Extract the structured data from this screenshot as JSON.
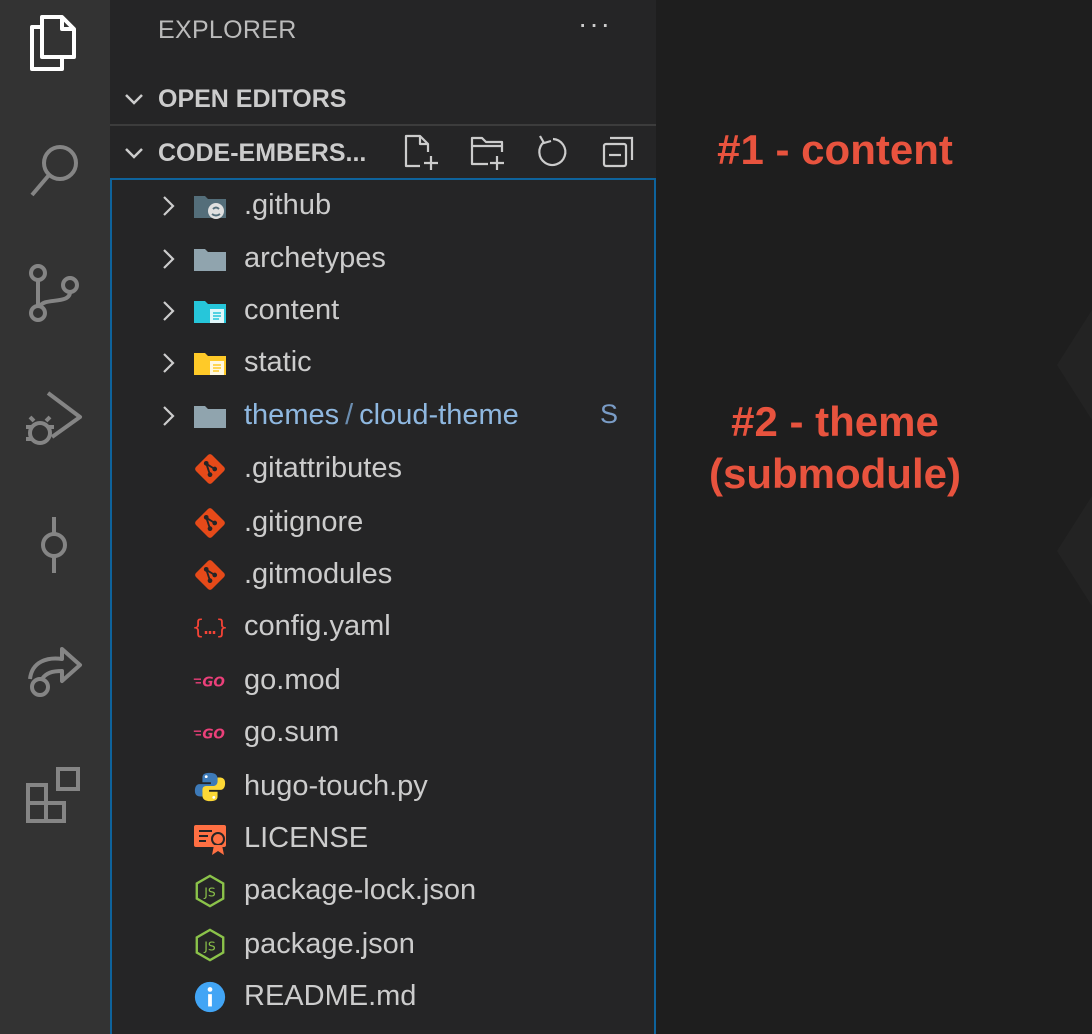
{
  "sidebar": {
    "title": "EXPLORER",
    "more_label": "···",
    "open_editors_label": "OPEN EDITORS",
    "folder_label": "CODE-EMBERS..."
  },
  "tree": [
    {
      "label": ".github",
      "type": "folder",
      "icon": "github-folder-icon"
    },
    {
      "label": "archetypes",
      "type": "folder",
      "icon": "folder-icon"
    },
    {
      "label": "content",
      "type": "folder",
      "icon": "content-folder-icon"
    },
    {
      "label": "static",
      "type": "folder",
      "icon": "static-folder-icon"
    },
    {
      "label_part1": "themes",
      "label_sep": "/",
      "label_part2": "cloud-theme",
      "badge": "S",
      "type": "submodule-folder",
      "icon": "folder-icon"
    },
    {
      "label": ".gitattributes",
      "type": "file",
      "icon": "git-icon"
    },
    {
      "label": ".gitignore",
      "type": "file",
      "icon": "git-icon"
    },
    {
      "label": ".gitmodules",
      "type": "file",
      "icon": "git-icon"
    },
    {
      "label": "config.yaml",
      "type": "file",
      "icon": "yaml-braces-icon"
    },
    {
      "label": "go.mod",
      "type": "file",
      "icon": "go-icon"
    },
    {
      "label": "go.sum",
      "type": "file",
      "icon": "go-icon"
    },
    {
      "label": "hugo-touch.py",
      "type": "file",
      "icon": "python-icon"
    },
    {
      "label": "LICENSE",
      "type": "file",
      "icon": "license-icon"
    },
    {
      "label": "package-lock.json",
      "type": "file",
      "icon": "nodejs-icon"
    },
    {
      "label": "package.json",
      "type": "file",
      "icon": "nodejs-icon"
    },
    {
      "label": "README.md",
      "type": "file",
      "icon": "info-icon"
    }
  ],
  "annotations": {
    "content": "#1 - content",
    "theme_line1": "#2 - theme",
    "theme_line2": "(submodule)"
  },
  "colors": {
    "annotation": "#e8533e",
    "tree_border": "#0e639c",
    "submodule_text": "#8fb8e0"
  }
}
